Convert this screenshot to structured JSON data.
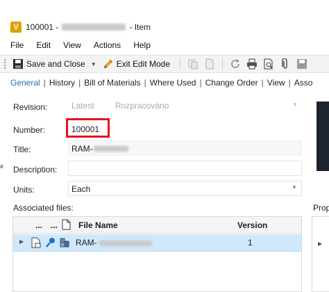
{
  "window": {
    "title_prefix": "100001 -",
    "title_suffix": "- Item",
    "app_icon_letter": "V"
  },
  "menu": [
    "File",
    "Edit",
    "View",
    "Actions",
    "Help"
  ],
  "toolbar": {
    "save_and_close": "Save and Close",
    "exit_edit_mode": "Exit Edit Mode"
  },
  "tabs": [
    "General",
    "History",
    "Bill of Materials",
    "Where Used",
    "Change Order",
    "View",
    "Asso"
  ],
  "form": {
    "revision_label": "Revision:",
    "revision_value": "Latest",
    "revision_state": "Rozpracováno",
    "number_label": "Number:",
    "number_value": "100001",
    "title_label": "Title:",
    "title_value": "RAM-",
    "description_label": "Description:",
    "description_value": "",
    "units_label": "Units:",
    "units_value": "Each"
  },
  "associated_files": {
    "label": "Associated files:",
    "columns": {
      "dots1": "...",
      "dots2": "...",
      "file_name": "File Name",
      "version": "Version"
    },
    "rows": [
      {
        "file_name": "RAM-",
        "version": "1"
      }
    ]
  },
  "properties": {
    "label": "Prop"
  },
  "colors": {
    "accent": "#1c6fb8",
    "highlight_border": "#e0141b",
    "selected_row": "#cfe8fb"
  }
}
